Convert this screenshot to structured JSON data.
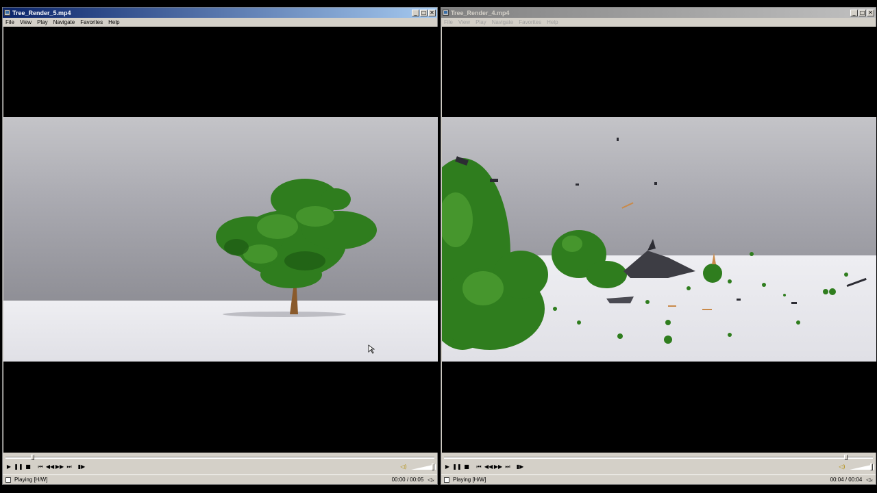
{
  "players": [
    {
      "title": "Tree_Render_5.mp4",
      "active": true,
      "menu": [
        "File",
        "View",
        "Play",
        "Navigate",
        "Favorites",
        "Help"
      ],
      "status": "Playing [H/W]",
      "time": "00:00 / 00:05",
      "progress": 0.06,
      "volume": 0.95
    },
    {
      "title": "Tree_Render_4.mp4",
      "active": false,
      "menu": [
        "File",
        "View",
        "Play",
        "Navigate",
        "Favorites",
        "Help"
      ],
      "status": "Playing [H/W]",
      "time": "00:04 / 00:04",
      "progress": 0.94,
      "volume": 0.95
    }
  ],
  "window_buttons": {
    "minimize": "_",
    "maximize": "□",
    "close": "✕"
  },
  "controls": {
    "play": "▶",
    "pause": "❚❚",
    "stop": "■",
    "prev": "⏮",
    "rewind": "◀◀",
    "forward": "▶▶",
    "next": "⏭",
    "step": "▮▶",
    "volume": "◁)",
    "mute": "◁ₓ"
  },
  "icons": [
    "app-icon",
    "play-icon",
    "pause-icon",
    "stop-icon",
    "skip-back-icon",
    "rewind-icon",
    "fast-forward-icon",
    "skip-forward-icon",
    "frame-step-icon",
    "speaker-icon",
    "mute-icon"
  ],
  "colors": {
    "titlebar_active": "#0a246a",
    "titlebar_inactive": "#808080",
    "chrome": "#d4d0c8",
    "foliage": "#2f7d1e",
    "trunk": "#8a5a2b"
  }
}
